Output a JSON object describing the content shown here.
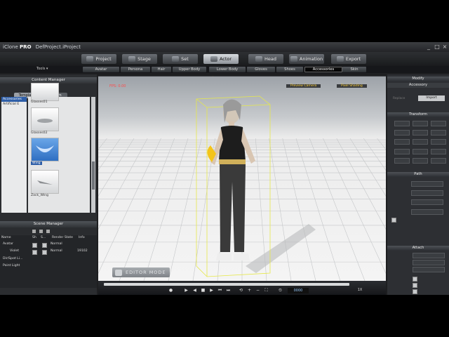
{
  "window": {
    "app_name": "iClone",
    "edition": "PRO",
    "project": "DefProject.iProject"
  },
  "main_tabs": [
    {
      "label": "Project",
      "active": false
    },
    {
      "label": "Stage",
      "active": false
    },
    {
      "label": "Set",
      "active": false
    },
    {
      "label": "Actor",
      "active": true
    },
    {
      "label": "Head",
      "active": false
    },
    {
      "label": "Animation",
      "active": false
    },
    {
      "label": "Export",
      "active": false
    }
  ],
  "sub_tabs": [
    {
      "label": "Avatar",
      "active": false
    },
    {
      "label": "Persona",
      "active": false
    },
    {
      "label": "Hair",
      "active": false
    },
    {
      "label": "Upper Body",
      "active": false
    },
    {
      "label": "Lower Body",
      "active": false
    },
    {
      "label": "Gloves",
      "active": false
    },
    {
      "label": "Shoes",
      "active": false
    },
    {
      "label": "Accessories",
      "active": true
    },
    {
      "label": "Skin",
      "active": false
    }
  ],
  "toolbar_left": {
    "tools_label": "Tools ▾"
  },
  "content_manager": {
    "title": "Content Manager",
    "tabs": [
      "Template",
      "Custom"
    ],
    "tree": [
      {
        "label": "Accessories",
        "selected": true
      },
      {
        "label": "Artificial E",
        "selected": false
      }
    ],
    "items": [
      {
        "label": "Glasses01",
        "selected": false
      },
      {
        "label": "Glasses02",
        "selected": false
      },
      {
        "label": "Wing",
        "selected": true
      },
      {
        "label": "Zack_Wing",
        "selected": false
      }
    ]
  },
  "scene_manager": {
    "title": "Scene Manager",
    "columns": [
      "Name",
      "Sh",
      "S...",
      "Render State",
      "Info"
    ],
    "rows": [
      {
        "name": "Avatar",
        "state": "Normal",
        "info": ""
      },
      {
        "name": "Violet",
        "state": "Normal",
        "info": "19102"
      },
      {
        "name": "Dir/Spot Li...",
        "state": "",
        "info": ""
      },
      {
        "name": "Point Light",
        "state": "",
        "info": ""
      }
    ]
  },
  "viewport": {
    "fps": "FPS: 0.00",
    "camera": "Preview Camera",
    "shading": "Pixel Shading",
    "mode": "EDITOR MODE"
  },
  "timeline": {
    "frame": "0000",
    "zoom": "1X"
  },
  "modify_panel": {
    "title": "Modify",
    "section_accessory": "Accessory",
    "section_transform": "Transform",
    "section_path": "Path",
    "section_attach": "Attach",
    "replace_label": "Replace",
    "import_label": "Import"
  },
  "colors": {
    "accent_yellow": "#ffd23a",
    "fps_red": "#ff4b4b",
    "selection_blue": "#2f5fa8"
  }
}
